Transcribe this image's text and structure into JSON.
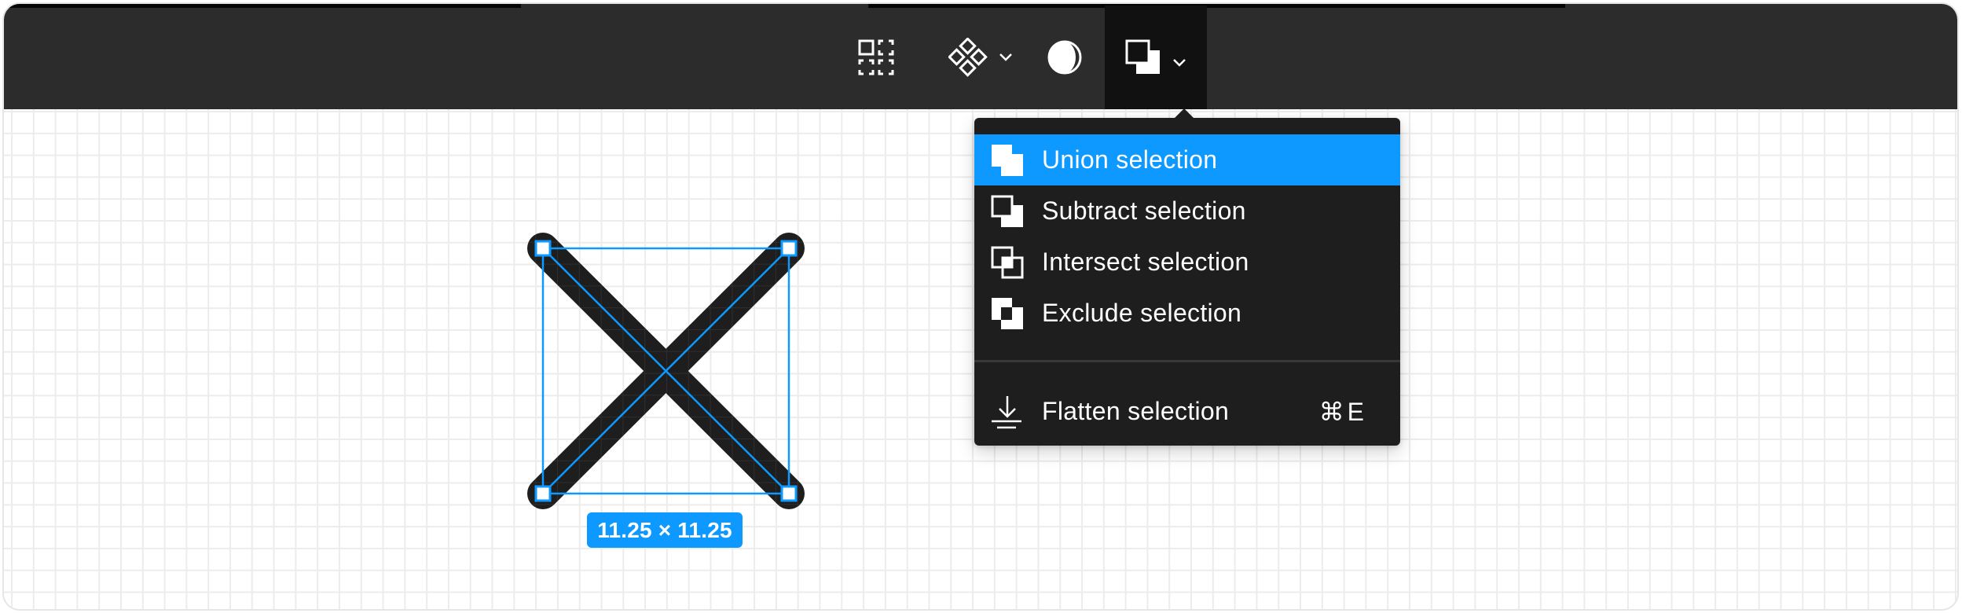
{
  "toolbar": {
    "buttons": [
      {
        "name": "auto-layout-selection",
        "icon": "grid-selection-icon",
        "has_dropdown": false,
        "active": false
      },
      {
        "name": "components",
        "icon": "component-icon",
        "has_dropdown": true,
        "active": false
      },
      {
        "name": "mask",
        "icon": "contrast-icon",
        "has_dropdown": false,
        "active": false
      },
      {
        "name": "boolean-operations",
        "icon": "boolean-subtract-icon",
        "has_dropdown": true,
        "active": true
      }
    ]
  },
  "canvas": {
    "selected_shape": {
      "type": "vector-x",
      "dimensions_label": "11.25 × 11.25",
      "width": 11.25,
      "height": 11.25
    }
  },
  "boolean_menu": {
    "items": [
      {
        "label": "Union selection",
        "icon": "union-icon",
        "highlighted": true,
        "shortcut": ""
      },
      {
        "label": "Subtract selection",
        "icon": "subtract-icon",
        "highlighted": false,
        "shortcut": ""
      },
      {
        "label": "Intersect selection",
        "icon": "intersect-icon",
        "highlighted": false,
        "shortcut": ""
      },
      {
        "label": "Exclude selection",
        "icon": "exclude-icon",
        "highlighted": false,
        "shortcut": ""
      }
    ],
    "flatten": {
      "label": "Flatten selection",
      "icon": "flatten-icon",
      "shortcut": "⌘E"
    }
  },
  "colors": {
    "toolbar_bg": "#2c2c2c",
    "active_button_bg": "#111111",
    "menu_bg": "#1e1e1e",
    "accent": "#0d99ff",
    "shape_stroke": "#1e1e1e"
  }
}
